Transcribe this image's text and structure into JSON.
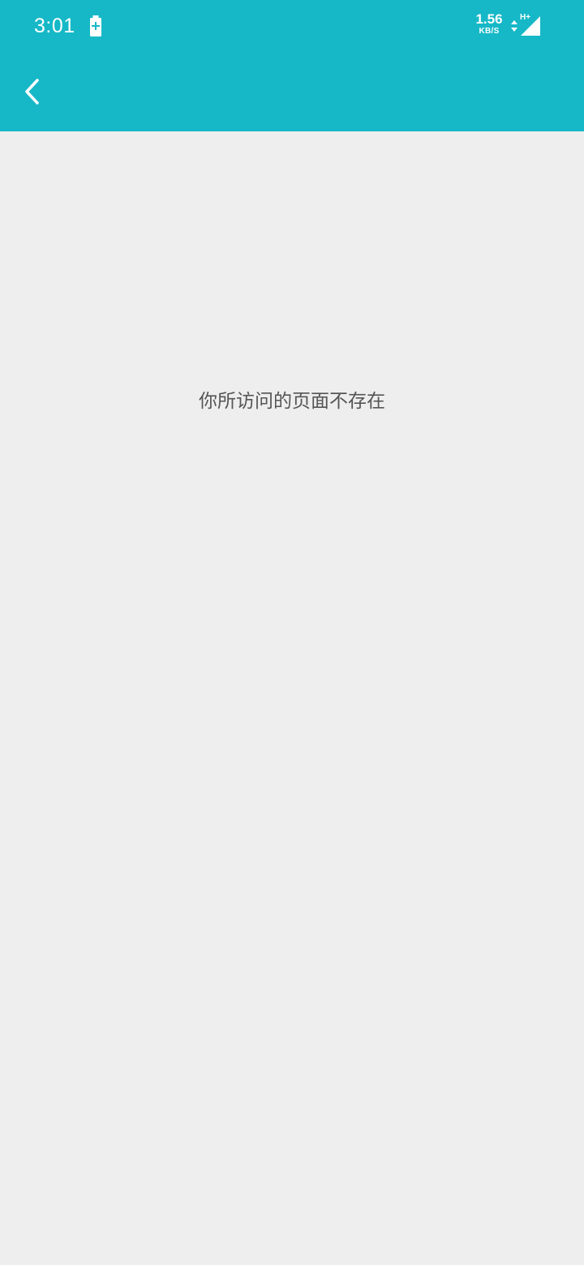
{
  "status_bar": {
    "time": "3:01",
    "battery_icon": "battery-charging-icon",
    "net_speed_value": "1.56",
    "net_speed_unit": "KB/S",
    "data_activity_icon": "data-arrows-icon",
    "network_type": "H+",
    "signal_icon": "cell-signal-icon"
  },
  "header": {
    "back_icon": "chevron-left-icon",
    "background_color": "#16b8c7"
  },
  "main": {
    "message": "你所访问的页面不存在",
    "background_color": "#eeeeee"
  }
}
